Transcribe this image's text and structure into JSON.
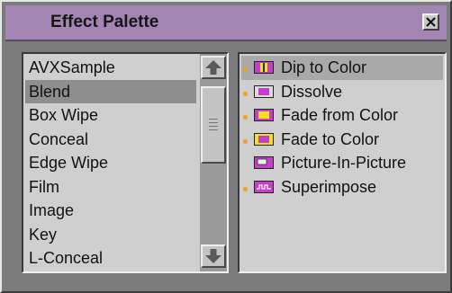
{
  "window": {
    "title": "Effect Palette"
  },
  "close_button": {
    "symbol": "×"
  },
  "categories": [
    "AVXSample",
    "Blend",
    "Box Wipe",
    "Conceal",
    "Edge Wipe",
    "Film",
    "Image",
    "Key",
    "L-Conceal"
  ],
  "selected_category": "Blend",
  "effects": [
    {
      "label": "Dip to Color",
      "icon": "dip-to-color-icon",
      "dot": true,
      "selected": true
    },
    {
      "label": "Dissolve",
      "icon": "dissolve-icon",
      "dot": true,
      "selected": false
    },
    {
      "label": "Fade from Color",
      "icon": "fade-from-color-icon",
      "dot": true,
      "selected": false
    },
    {
      "label": "Fade to Color",
      "icon": "fade-to-color-icon",
      "dot": true,
      "selected": false
    },
    {
      "label": "Picture-In-Picture",
      "icon": "picture-in-picture-icon",
      "dot": false,
      "selected": false
    },
    {
      "label": "Superimpose",
      "icon": "superimpose-icon",
      "dot": true,
      "selected": false
    }
  ],
  "scroll": {
    "position_fraction": 0.12
  },
  "colors": {
    "title_bar": "#a385b4",
    "effect_icon": "#c53fcb",
    "bullet": "#f0a020",
    "yellow_accent": "#f2e21c"
  }
}
